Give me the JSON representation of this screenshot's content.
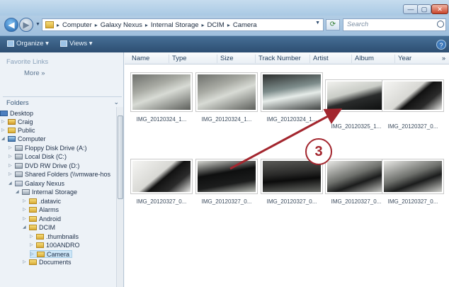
{
  "window": {
    "min_glyph": "—",
    "max_glyph": "▢",
    "close_glyph": "✕"
  },
  "address": {
    "crumbs": [
      "Computer",
      "Galaxy Nexus",
      "Internal Storage",
      "DCIM",
      "Camera"
    ],
    "separator": "▸"
  },
  "search": {
    "placeholder": "Search"
  },
  "toolbar": {
    "organize_label": "Organize ▾",
    "views_label": "Views ▾",
    "help_glyph": "?"
  },
  "navpane": {
    "favorites_header": "Favorite Links",
    "more_label": "More »",
    "folders_header": "Folders",
    "tree": [
      {
        "label": "Desktop"
      },
      {
        "label": "Craig"
      },
      {
        "label": "Public"
      },
      {
        "label": "Computer"
      },
      {
        "label": "Floppy Disk Drive (A:)"
      },
      {
        "label": "Local Disk (C:)"
      },
      {
        "label": "DVD RW Drive (D:)"
      },
      {
        "label": "Shared Folders (\\\\vmware-hos"
      },
      {
        "label": "Galaxy Nexus"
      },
      {
        "label": "Internal Storage"
      },
      {
        "label": ".datavic"
      },
      {
        "label": "Alarms"
      },
      {
        "label": "Android"
      },
      {
        "label": "DCIM"
      },
      {
        "label": ".thumbnails"
      },
      {
        "label": "100ANDRO"
      },
      {
        "label": "Camera"
      },
      {
        "label": "Documents"
      }
    ]
  },
  "columns": [
    "Name",
    "Type",
    "Size",
    "Track Number",
    "Artist",
    "Album",
    "Year",
    "»"
  ],
  "files": [
    {
      "name": "IMG_20120324_1..."
    },
    {
      "name": "IMG_20120324_1..."
    },
    {
      "name": "IMG_20120324_1..."
    },
    {
      "name": "IMG_20120325_1..."
    },
    {
      "name": "IMG_20120327_0..."
    },
    {
      "name": "IMG_20120327_0..."
    },
    {
      "name": "IMG_20120327_0..."
    },
    {
      "name": "IMG_20120327_0..."
    },
    {
      "name": "IMG_20120327_0..."
    },
    {
      "name": "IMG_20120327_0..."
    }
  ],
  "annotation": {
    "step_number": "3",
    "color": "#a3262e"
  }
}
